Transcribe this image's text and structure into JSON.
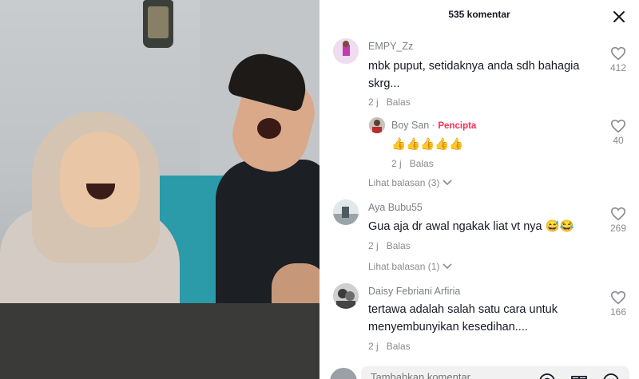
{
  "panel": {
    "title": "535 komentar"
  },
  "comments": [
    {
      "username": "EMPY_Zz",
      "text": "mbk puput, setidaknya anda sdh bahagia skrg...",
      "time": "2 j",
      "reply_label": "Balas",
      "likes": "412",
      "view_replies": ""
    },
    {
      "username": "Boy San",
      "creator_badge": "Pencipta",
      "text": "👍👍👍👍👍",
      "time": "2 j",
      "reply_label": "Balas",
      "likes": "40"
    },
    {
      "username": "Aya Bubu55",
      "text": "Gua aja dr awal ngakak liat vt nya 😅😂",
      "time": "2 j",
      "reply_label": "Balas",
      "likes": "269"
    },
    {
      "username": "Daisy Febriani Arfiria",
      "text": "tertawa adalah salah satu cara untuk menyembunyikan kesedihan....",
      "time": "2 j",
      "reply_label": "Balas",
      "likes": "166"
    }
  ],
  "view_replies": {
    "first": "Lihat balasan (3)",
    "second": "Lihat balasan (1)"
  },
  "input": {
    "placeholder": "Tambahkan komentar..."
  },
  "icons": {
    "close": "close-icon",
    "like": "heart-outline-icon",
    "chevron": "chevron-down-icon",
    "mention": "at-icon",
    "emoji": "emoji-icon",
    "gift": "gift-icon"
  },
  "colors": {
    "creator_badge": "#fe2c55",
    "secondary_text": "#8a8b91"
  }
}
